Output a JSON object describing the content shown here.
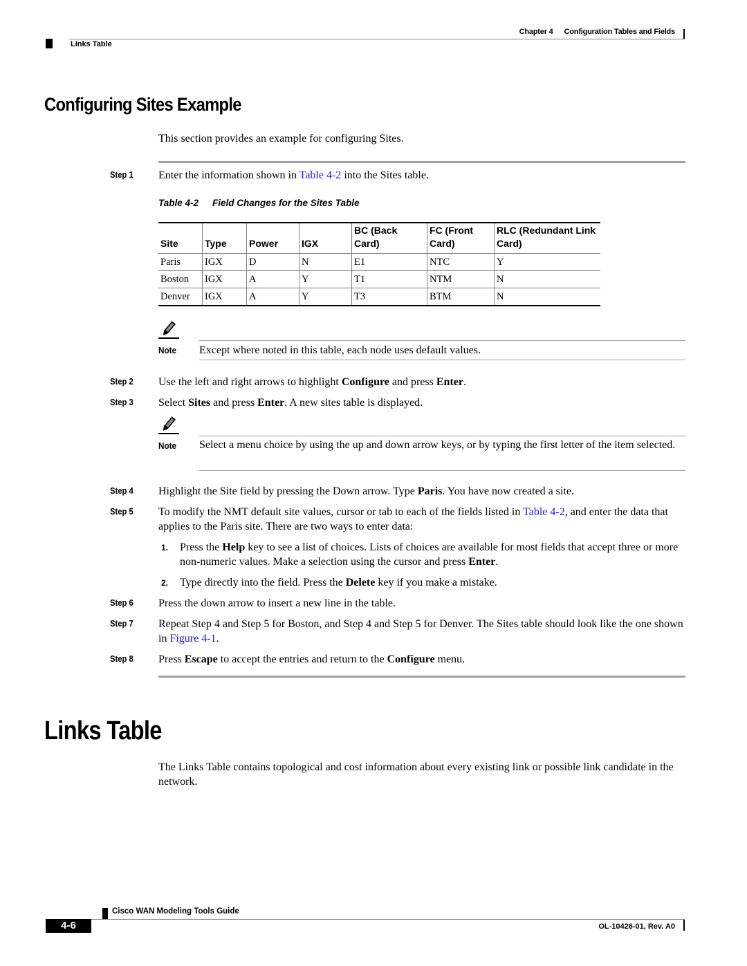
{
  "header": {
    "chapter_label": "Chapter 4",
    "chapter_title": "Configuration Tables and Fields",
    "section": "Links Table"
  },
  "section1": {
    "title": "Configuring Sites Example",
    "intro": "This section provides an example for configuring Sites."
  },
  "steps": {
    "s1": {
      "label": "Step 1",
      "pre": "Enter the information shown in ",
      "link": "Table 4-2",
      "post": " into the Sites table."
    },
    "s2": {
      "label": "Step 2",
      "t1": "Use the left and right arrows to highlight ",
      "b1": "Configure",
      "t2": " and press ",
      "b2": "Enter",
      "t3": "."
    },
    "s3": {
      "label": "Step 3",
      "t1": "Select ",
      "b1": "Sites",
      "t2": " and press ",
      "b2": "Enter",
      "t3": ". A new sites table is displayed."
    },
    "s4": {
      "label": "Step 4",
      "t1": "Highlight the Site field by pressing the Down arrow. Type ",
      "b1": "Paris",
      "t2": ". You have now created a site."
    },
    "s5": {
      "label": "Step 5",
      "t1": "To modify the NMT default site values, cursor or tab to each of the fields listed in ",
      "link": "Table 4-2",
      "t2": ", and enter the data that applies to the Paris site. There are two ways to enter data:"
    },
    "s5_items": [
      {
        "num": "1.",
        "t1": "Press the ",
        "b1": "Help",
        "t2": " key to see a list of choices. Lists of choices are available for most fields that accept three or more non-numeric values. Make a selection using the cursor and press ",
        "b2": "Enter",
        "t3": "."
      },
      {
        "num": "2.",
        "t1": "Type directly into the field. Press the ",
        "b1": "Delete",
        "t2": " key if you make a mistake."
      }
    ],
    "s6": {
      "label": "Step 6",
      "text": "Press the down arrow to insert a new line in the table."
    },
    "s7": {
      "label": "Step 7",
      "t1": "Repeat Step 4 and Step 5 for Boston, and Step 4 and Step 5 for Denver. The Sites table should look like the one shown in ",
      "link": "Figure 4-1",
      "t2": "."
    },
    "s8": {
      "label": "Step 8",
      "t1": "Press ",
      "b1": "Escape",
      "t2": " to accept the entries and return to the ",
      "b2": "Configure",
      "t3": " menu."
    }
  },
  "table": {
    "caption_num": "Table 4-2",
    "caption_title": "Field Changes for the Sites Table",
    "headers": [
      "Site",
      "Type",
      "Power",
      "IGX",
      "BC (Back Card)",
      "FC (Front Card)",
      "RLC (Redundant Link Card)"
    ],
    "rows": [
      [
        "Paris",
        "IGX",
        "D",
        "N",
        "E1",
        "NTC",
        "Y"
      ],
      [
        "Boston",
        "IGX",
        "A",
        "Y",
        "T1",
        "NTM",
        "N"
      ],
      [
        "Denver",
        "IGX",
        "A",
        "Y",
        "T3",
        "BTM",
        "N"
      ]
    ]
  },
  "notes": [
    {
      "label": "Note",
      "icon": "pencil-note-icon",
      "text": "Except where noted in this table, each node uses default values."
    },
    {
      "label": "Note",
      "icon": "pencil-note-icon",
      "text": "Select a menu choice by using the up and down arrow keys, or by typing the first letter of the item selected."
    }
  ],
  "section2": {
    "title": "Links Table",
    "intro": "The Links Table contains topological and cost information about every existing link or possible link candidate in the network."
  },
  "footer": {
    "guide_title": "Cisco WAN Modeling Tools Guide",
    "page_number": "4-6",
    "doc_id": "OL-10426-01, Rev. A0"
  },
  "colors": {
    "link": "#1a1aff",
    "rule": "#a0a0a0"
  }
}
